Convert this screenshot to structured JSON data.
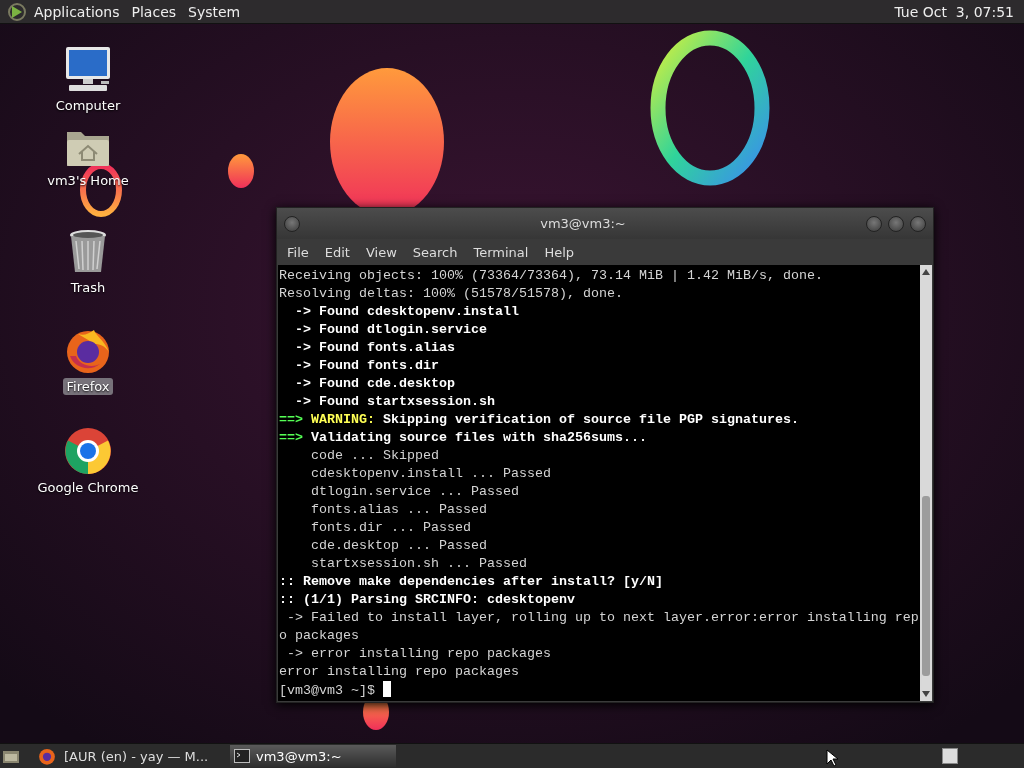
{
  "top_panel": {
    "menus": [
      "Applications",
      "Places",
      "System"
    ],
    "clock": "Tue Oct  3, 07:51"
  },
  "desktop_icons": [
    {
      "label": "Computer",
      "kind": "computer",
      "selected": false
    },
    {
      "label": "vm3's Home",
      "kind": "home",
      "selected": false
    },
    {
      "label": "Trash",
      "kind": "trash",
      "selected": false
    },
    {
      "label": "Firefox",
      "kind": "firefox",
      "selected": true
    },
    {
      "label": "Google Chrome",
      "kind": "chrome",
      "selected": false
    }
  ],
  "terminal": {
    "title": "vm3@vm3:~",
    "menu": [
      "File",
      "Edit",
      "View",
      "Search",
      "Terminal",
      "Help"
    ],
    "lines": [
      {
        "segments": [
          {
            "text": "Receiving objects: 100% (73364/73364), 73.14 MiB | 1.42 MiB/s, done.",
            "kind": "plain"
          }
        ]
      },
      {
        "segments": [
          {
            "text": "Resolving deltas: 100% (51578/51578), done.",
            "kind": "plain"
          }
        ]
      },
      {
        "segments": [
          {
            "text": "  -> Found cdesktopenv.install",
            "kind": "bold"
          }
        ]
      },
      {
        "segments": [
          {
            "text": "  -> Found dtlogin.service",
            "kind": "bold"
          }
        ]
      },
      {
        "segments": [
          {
            "text": "  -> Found fonts.alias",
            "kind": "bold"
          }
        ]
      },
      {
        "segments": [
          {
            "text": "  -> Found fonts.dir",
            "kind": "bold"
          }
        ]
      },
      {
        "segments": [
          {
            "text": "  -> Found cde.desktop",
            "kind": "bold"
          }
        ]
      },
      {
        "segments": [
          {
            "text": "  -> Found startxsession.sh",
            "kind": "bold"
          }
        ]
      },
      {
        "segments": [
          {
            "text": "==>",
            "kind": "marker"
          },
          {
            "text": " WARNING:",
            "kind": "warning"
          },
          {
            "text": " Skipping verification of source file PGP signatures.",
            "kind": "bold"
          }
        ]
      },
      {
        "segments": [
          {
            "text": "==>",
            "kind": "marker"
          },
          {
            "text": " Validating source files with sha256sums...",
            "kind": "bold"
          }
        ]
      },
      {
        "segments": [
          {
            "text": "    code ... Skipped",
            "kind": "plain"
          }
        ]
      },
      {
        "segments": [
          {
            "text": "    cdesktopenv.install ... Passed",
            "kind": "plain"
          }
        ]
      },
      {
        "segments": [
          {
            "text": "    dtlogin.service ... Passed",
            "kind": "plain"
          }
        ]
      },
      {
        "segments": [
          {
            "text": "    fonts.alias ... Passed",
            "kind": "plain"
          }
        ]
      },
      {
        "segments": [
          {
            "text": "    fonts.dir ... Passed",
            "kind": "plain"
          }
        ]
      },
      {
        "segments": [
          {
            "text": "    cde.desktop ... Passed",
            "kind": "plain"
          }
        ]
      },
      {
        "segments": [
          {
            "text": "    startxsession.sh ... Passed",
            "kind": "plain"
          }
        ]
      },
      {
        "segments": [
          {
            "text": ":: Remove make dependencies after install? [y/N]",
            "kind": "bold"
          }
        ]
      },
      {
        "segments": [
          {
            "text": ":: (1/1) Parsing SRCINFO: cdesktopenv",
            "kind": "bold"
          }
        ]
      },
      {
        "segments": [
          {
            "text": " -> Failed to install layer, rolling up to next layer.error:error installing rep",
            "kind": "plain"
          }
        ]
      },
      {
        "segments": [
          {
            "text": "o packages",
            "kind": "plain"
          }
        ]
      },
      {
        "segments": [
          {
            "text": " -> error installing repo packages",
            "kind": "plain"
          }
        ]
      },
      {
        "segments": [
          {
            "text": "error installing repo packages",
            "kind": "plain"
          }
        ]
      }
    ],
    "prompt": "[vm3@vm3 ~]$"
  },
  "taskbar": {
    "tasks": [
      {
        "label": "[AUR (en) - yay — M...",
        "kind": "browser",
        "selected": false
      },
      {
        "label": "vm3@vm3:~",
        "kind": "terminal",
        "selected": true
      }
    ]
  }
}
